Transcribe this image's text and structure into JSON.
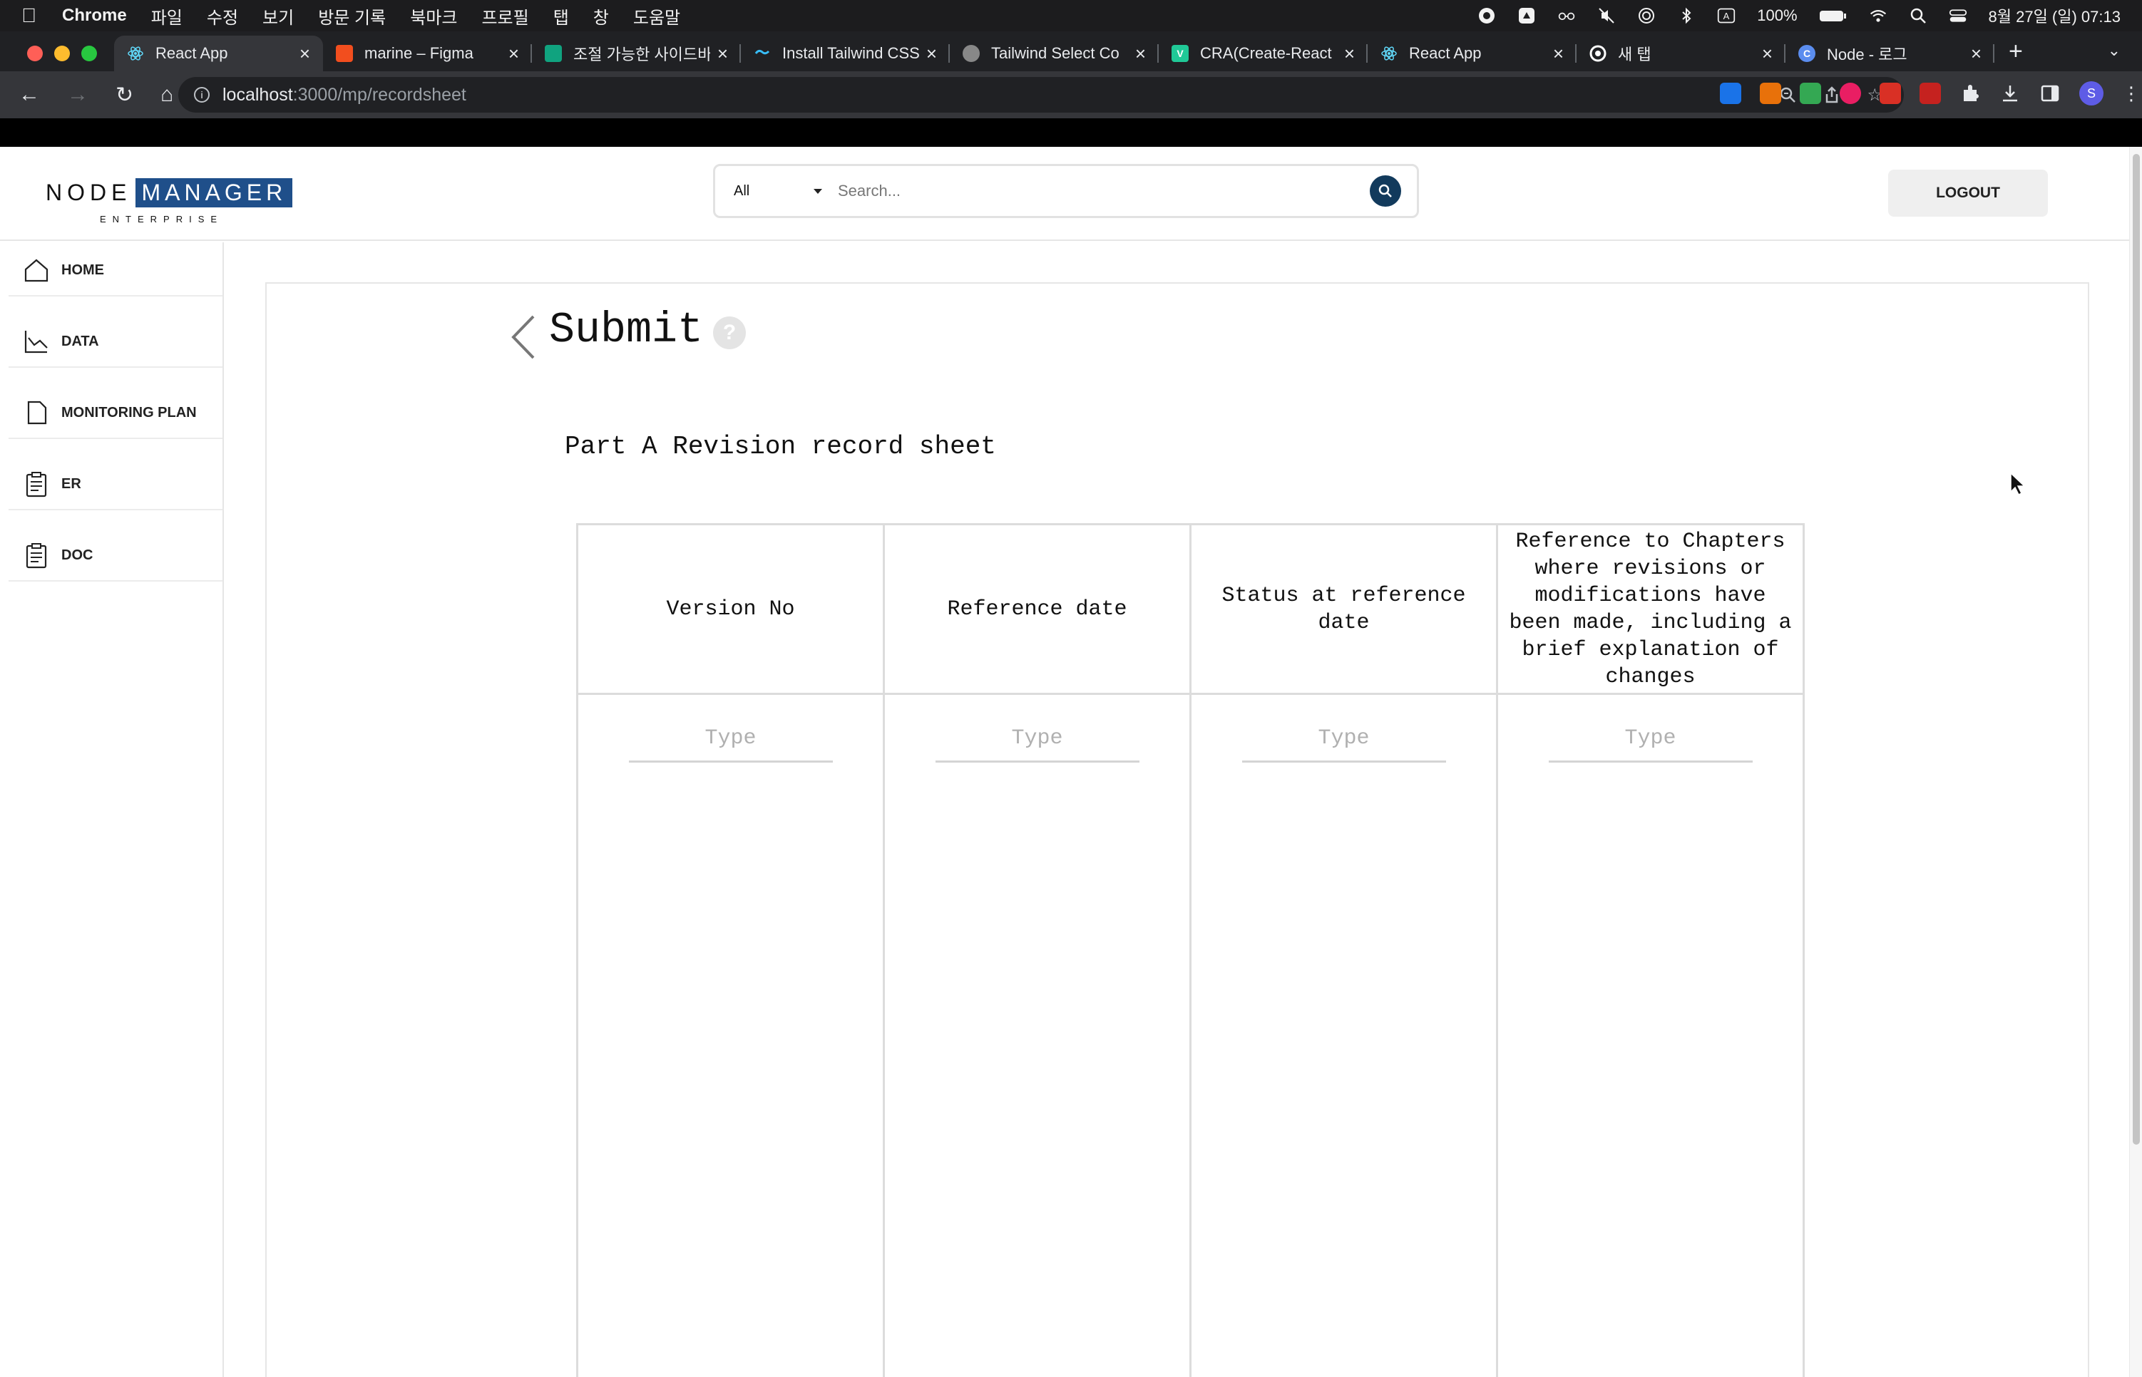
{
  "menubar": {
    "app": "Chrome",
    "items": [
      "파일",
      "수정",
      "보기",
      "방문 기록",
      "북마크",
      "프로필",
      "탭",
      "창",
      "도움말"
    ],
    "battery": "100%",
    "clock": "8월 27일 (일) 07:13"
  },
  "tabs": [
    {
      "label": "React App",
      "favicon_color": "#61dafb",
      "active": true
    },
    {
      "label": "marine – Figma",
      "favicon_color": "#f24e1e"
    },
    {
      "label": "조절 가능한 사이드바",
      "favicon_color": "#10a37f"
    },
    {
      "label": "Install Tailwind CSS",
      "favicon_color": "#38bdf8"
    },
    {
      "label": "Tailwind Select Co",
      "favicon_color": "#888888"
    },
    {
      "label": "CRA(Create-React",
      "favicon_color": "#20c997"
    },
    {
      "label": "React App",
      "favicon_color": "#61dafb"
    },
    {
      "label": "새 탭",
      "favicon_color": "#ffffff"
    },
    {
      "label": "Node - 로그",
      "favicon_color": "#5b8def"
    }
  ],
  "address": {
    "host": "localhost",
    "path": ":3000/mp/recordsheet"
  },
  "app": {
    "logo_node": "NODE",
    "logo_manager": "MANAGER",
    "logo_enterprise": "ENTERPRISE",
    "search_filter": "All",
    "search_placeholder": "Search...",
    "logout_label": "LOGOUT",
    "brand_color": "#1f4f8a"
  },
  "sidebar": {
    "items": [
      {
        "label": "HOME",
        "icon": "home-icon"
      },
      {
        "label": "DATA",
        "icon": "chart-icon"
      },
      {
        "label": "MONITORING PLAN",
        "icon": "document-icon"
      },
      {
        "label": "ER",
        "icon": "clipboard-icon"
      },
      {
        "label": "DOC",
        "icon": "clipboard-icon"
      }
    ]
  },
  "main": {
    "title": "Submit",
    "help": "?",
    "subtitle": "Part A Revision record sheet",
    "table": {
      "headers": [
        "Version No",
        "Reference date",
        "Status at reference date",
        "Reference to Chapters where revisions or modifications have been made, including a brief explanation of changes"
      ],
      "input_placeholder": "Type"
    }
  }
}
